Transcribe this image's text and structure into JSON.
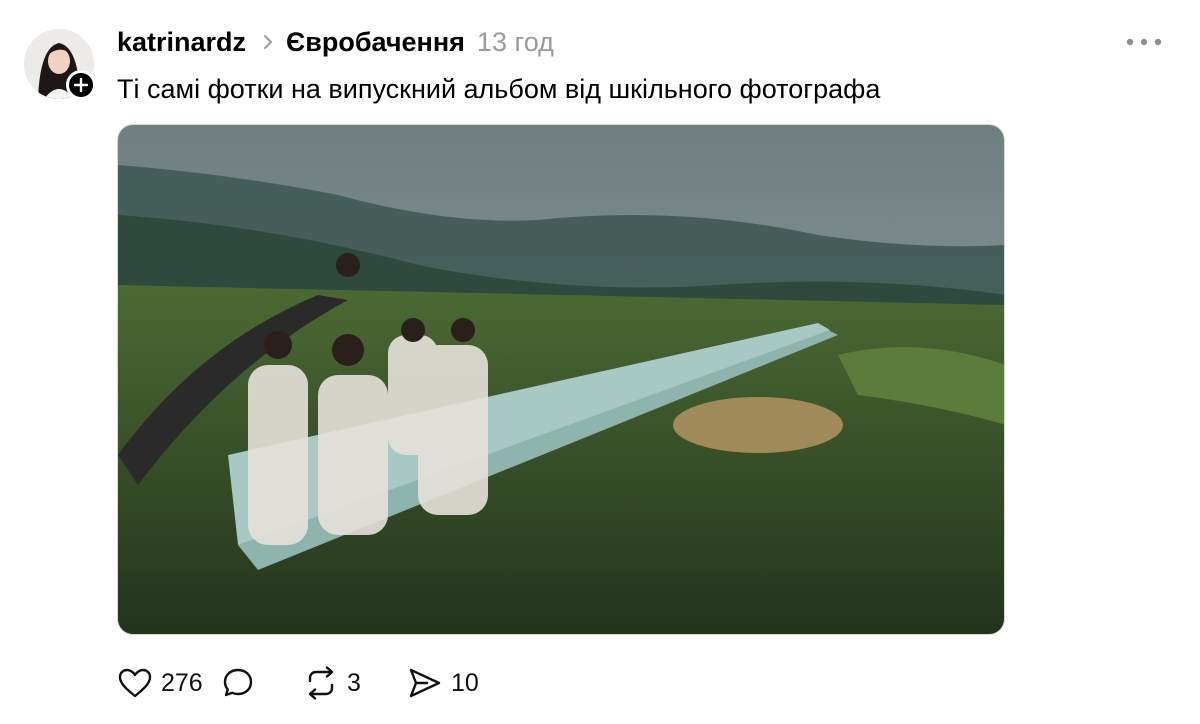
{
  "post": {
    "author": "katrinardz",
    "community": "Євробачення",
    "time": "13 год",
    "text": "Ті самі фотки на випускний альбом від шкільного фотографа"
  },
  "media": {
    "description_icon": "photo-image"
  },
  "actions": {
    "likes": "276",
    "comments": "",
    "reposts": "3",
    "shares": "10"
  },
  "colors": {
    "text": "#000000",
    "muted": "#9a9a9a",
    "background": "#ffffff"
  }
}
